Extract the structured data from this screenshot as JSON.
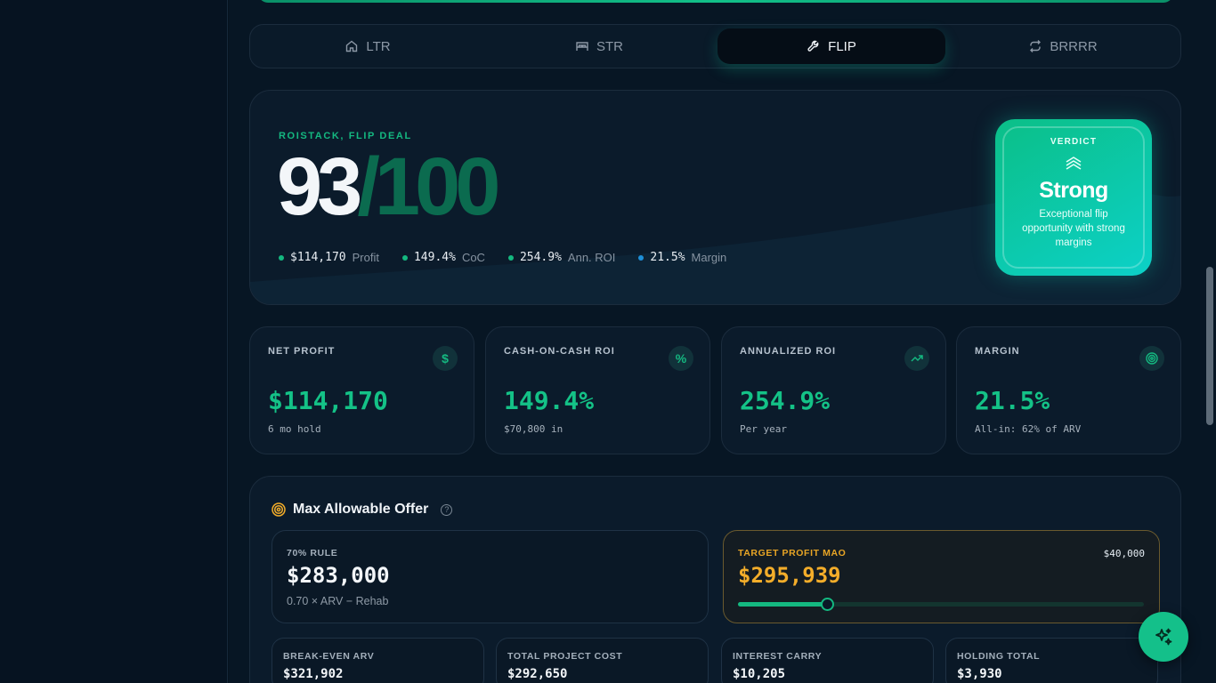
{
  "tabs": [
    {
      "label": "LTR",
      "icon": "home-icon",
      "active": false
    },
    {
      "label": "STR",
      "icon": "bed-icon",
      "active": false
    },
    {
      "label": "FLIP",
      "icon": "wrench-icon",
      "active": true
    },
    {
      "label": "BRRRR",
      "icon": "repeat-icon",
      "active": false
    }
  ],
  "hero": {
    "eyebrow": "ROISTACK, FLIP DEAL",
    "score": "93",
    "score_max": "/100",
    "stats": [
      {
        "value": "$114,170",
        "label": "Profit",
        "color": "#14b880"
      },
      {
        "value": "149.4%",
        "label": "CoC",
        "color": "#14b880"
      },
      {
        "value": "254.9%",
        "label": "Ann. ROI",
        "color": "#14b880"
      },
      {
        "value": "21.5%",
        "label": "Margin",
        "color": "#1e8fd8"
      }
    ]
  },
  "verdict": {
    "label": "VERDICT",
    "title": "Strong",
    "description": "Exceptional flip opportunity with strong margins",
    "icon": "chevrons-up-icon"
  },
  "cards": [
    {
      "label": "NET PROFIT",
      "value": "$114,170",
      "sub": "6 mo hold",
      "icon": "dollar-icon"
    },
    {
      "label": "CASH-ON-CASH ROI",
      "value": "149.4%",
      "sub": "$70,800 in",
      "icon": "percent-icon"
    },
    {
      "label": "ANNUALIZED ROI",
      "value": "254.9%",
      "sub": "Per year",
      "icon": "trending-up-icon"
    },
    {
      "label": "MARGIN",
      "value": "21.5%",
      "sub": "All-in: 62% of ARV",
      "icon": "target-icon"
    }
  ],
  "mao": {
    "title": "Max Allowable Offer",
    "rule": {
      "label": "70% RULE",
      "value": "$283,000",
      "formula": "0.70 × ARV − Rehab"
    },
    "target": {
      "label": "TARGET PROFIT MAO",
      "value": "$295,939",
      "target_profit": "$40,000",
      "slider_fraction": 0.22
    },
    "metrics": [
      {
        "label": "BREAK-EVEN ARV",
        "value": "$321,902"
      },
      {
        "label": "TOTAL PROJECT COST",
        "value": "$292,650"
      },
      {
        "label": "INTEREST CARRY",
        "value": "$10,205"
      },
      {
        "label": "HOLDING TOTAL",
        "value": "$3,930"
      }
    ]
  },
  "colors": {
    "accent": "#14b880",
    "warning": "#f3ad2a",
    "background": "#071624"
  },
  "fab_icon": "sparkles-icon"
}
